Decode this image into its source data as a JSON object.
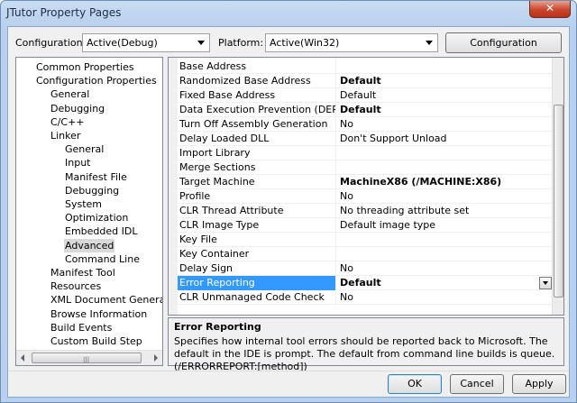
{
  "window": {
    "title": "JTutor Property Pages",
    "close_glyph": "✕"
  },
  "config": {
    "configuration_label": "Configuration:",
    "configuration_value": "Active(Debug)",
    "platform_label": "Platform:",
    "platform_value": "Active(Win32)",
    "manager_button": "Configuration Manager..."
  },
  "tree": {
    "items": [
      {
        "label": "Common Properties",
        "indent": 0
      },
      {
        "label": "Configuration Properties",
        "indent": 0
      },
      {
        "label": "General",
        "indent": 1
      },
      {
        "label": "Debugging",
        "indent": 1
      },
      {
        "label": "C/C++",
        "indent": 1
      },
      {
        "label": "Linker",
        "indent": 1
      },
      {
        "label": "General",
        "indent": 2
      },
      {
        "label": "Input",
        "indent": 2
      },
      {
        "label": "Manifest File",
        "indent": 2
      },
      {
        "label": "Debugging",
        "indent": 2
      },
      {
        "label": "System",
        "indent": 2
      },
      {
        "label": "Optimization",
        "indent": 2
      },
      {
        "label": "Embedded IDL",
        "indent": 2
      },
      {
        "label": "Advanced",
        "indent": 2,
        "selected": true
      },
      {
        "label": "Command Line",
        "indent": 2
      },
      {
        "label": "Manifest Tool",
        "indent": 1
      },
      {
        "label": "Resources",
        "indent": 1
      },
      {
        "label": "XML Document Generator",
        "indent": 1
      },
      {
        "label": "Browse Information",
        "indent": 1
      },
      {
        "label": "Build Events",
        "indent": 1
      },
      {
        "label": "Custom Build Step",
        "indent": 1
      }
    ],
    "scroll_grip": "|||"
  },
  "grid": {
    "rows": [
      {
        "name": "Base Address",
        "value": "",
        "bold": false
      },
      {
        "name": "Randomized Base Address",
        "value": "Default",
        "bold": true
      },
      {
        "name": "Fixed Base Address",
        "value": "Default",
        "bold": false
      },
      {
        "name": "Data Execution Prevention (DEP)",
        "value": "Default",
        "bold": true
      },
      {
        "name": "Turn Off Assembly Generation",
        "value": "No",
        "bold": false
      },
      {
        "name": "Delay Loaded DLL",
        "value": "Don't Support Unload",
        "bold": false
      },
      {
        "name": "Import Library",
        "value": "",
        "bold": false
      },
      {
        "name": "Merge Sections",
        "value": "",
        "bold": false
      },
      {
        "name": "Target Machine",
        "value": "MachineX86 (/MACHINE:X86)",
        "bold": true
      },
      {
        "name": "Profile",
        "value": "No",
        "bold": false
      },
      {
        "name": "CLR Thread Attribute",
        "value": "No threading attribute set",
        "bold": false
      },
      {
        "name": "CLR Image Type",
        "value": "Default image type",
        "bold": false
      },
      {
        "name": "Key File",
        "value": "",
        "bold": false
      },
      {
        "name": "Key Container",
        "value": "",
        "bold": false
      },
      {
        "name": "Delay Sign",
        "value": "No",
        "bold": false
      },
      {
        "name": "Error Reporting",
        "value": "Default",
        "bold": true,
        "selected": true
      },
      {
        "name": "CLR Unmanaged Code Check",
        "value": "No",
        "bold": false
      }
    ]
  },
  "description": {
    "title": "Error Reporting",
    "text": "Specifies how internal tool errors should be reported back to Microsoft.  The default in the IDE is prompt.  The default from command line builds is queue.      (/ERRORREPORT:[method])"
  },
  "buttons": {
    "ok": "OK",
    "cancel": "Cancel",
    "apply": "Apply"
  },
  "colors": {
    "selection": "#3399ff",
    "title_bar": "#b9d1ee",
    "close_button": "#c9462c"
  }
}
